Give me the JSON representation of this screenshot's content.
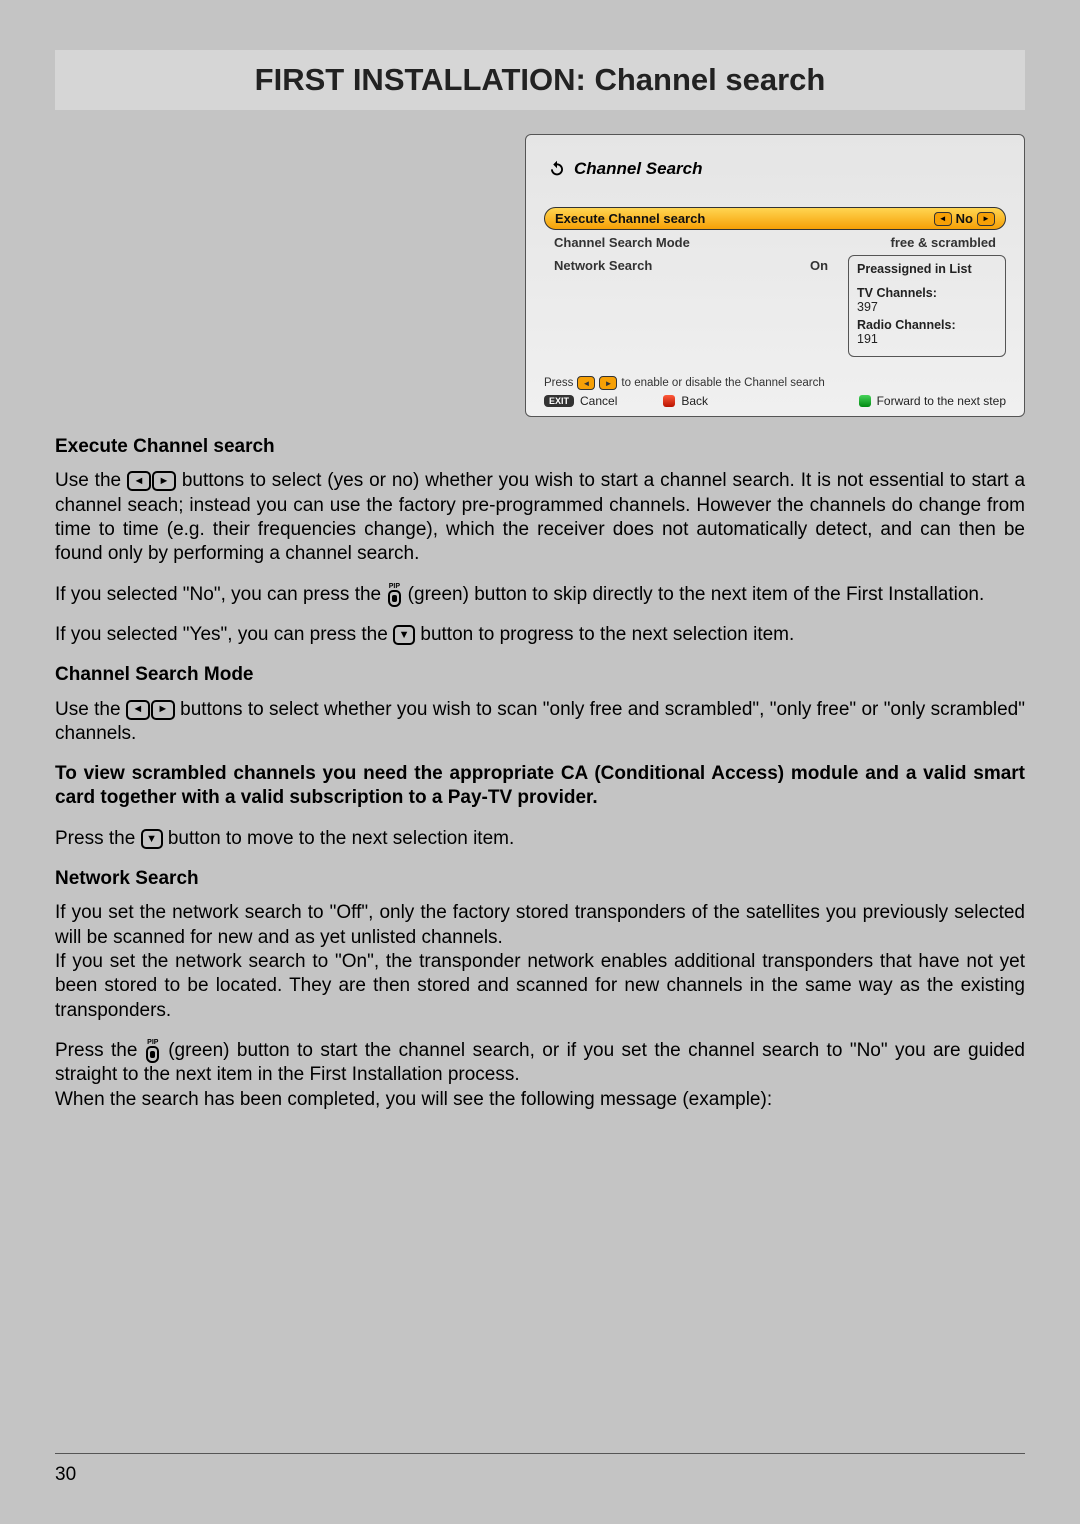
{
  "title": "FIRST INSTALLATION: Channel search",
  "page_number": "30",
  "screenshot": {
    "header": "Channel Search",
    "rows": {
      "execute": {
        "label": "Execute Channel search",
        "value": "No"
      },
      "mode": {
        "label": "Channel Search Mode",
        "value": "free & scrambled"
      },
      "network": {
        "label": "Network Search",
        "value": "On"
      }
    },
    "panel": {
      "heading": "Preassigned in List",
      "tv_label": "TV Channels:",
      "tv_count": "397",
      "radio_label": "Radio Channels:",
      "radio_count": "191"
    },
    "hint_prefix": "Press",
    "hint_suffix": "to enable or disable the Channel search",
    "footer": {
      "exit": "EXIT",
      "cancel": "Cancel",
      "back": "Back",
      "forward": "Forward to the next step"
    }
  },
  "sections": {
    "s1_head": "Execute Channel search",
    "s1_p1a": "Use the ",
    "s1_p1b": " buttons to select (yes or no) whether you wish to start a channel search. It is not essential to start a channel seach; instead you can use the factory pre-programmed channels. However the channels do change from time to time (e.g. their frequencies change), which the receiver does not automatically detect, and can then be found only by performing a channel search.",
    "s1_p2a": "If you selected \"No\", you can press the ",
    "s1_p2b": " (green) button to skip directly to the next item of the First Installation.",
    "s1_p3a": "If you selected \"Yes\", you can press the ",
    "s1_p3b": " button to progress to the next selection item.",
    "s2_head": "Channel Search Mode",
    "s2_p1a": "Use the ",
    "s2_p1b": " buttons to select whether you wish to scan \"only free and scrambled\", \"only free\" or \"only scrambled\" channels.",
    "s2_bold": "To view scrambled channels you need the appropriate CA (Conditional Access) module and a valid smart card together with a valid subscription to a Pay-TV provider.",
    "s2_p2a": "Press the ",
    "s2_p2b": " button to move to the next selection item.",
    "s3_head": "Network Search",
    "s3_p1": "If you set the network search to \"Off\", only the factory stored transponders of the satellites you previously selected will be scanned for new and as yet unlisted channels.",
    "s3_p2": "If you set the network search to \"On\", the transponder network enables additional transponders that have not yet been stored to be located. They are then stored and scanned for new channels in the same way as the existing transponders.",
    "s3_p3a": "Press the ",
    "s3_p3b": " (green) button to start the channel search, or if you set the channel search to \"No\" you are guided straight to the next item in the First Installation process.",
    "s3_p4": "When the search has been completed, you will see the following message (example):"
  }
}
